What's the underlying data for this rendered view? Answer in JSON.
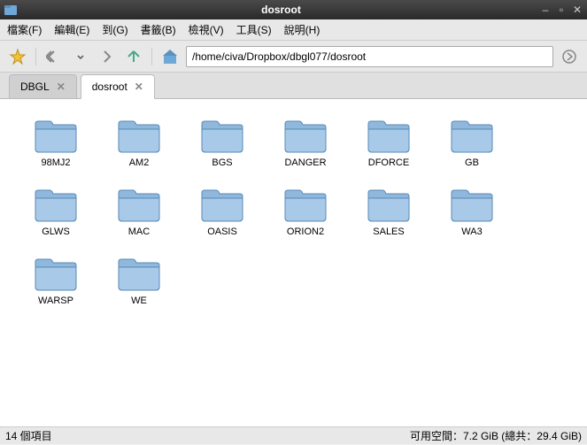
{
  "window": {
    "title": "dosroot"
  },
  "menu": {
    "file": "檔案(F)",
    "edit": "編輯(E)",
    "go": "到(G)",
    "bookmarks": "書籤(B)",
    "view": "檢視(V)",
    "tools": "工具(S)",
    "help": "說明(H)"
  },
  "toolbar": {
    "path": "/home/civa/Dropbox/dbgl077/dosroot"
  },
  "tabs": [
    {
      "label": "DBGL",
      "active": false
    },
    {
      "label": "dosroot",
      "active": true
    }
  ],
  "folders": [
    {
      "name": "98MJ2"
    },
    {
      "name": "AM2"
    },
    {
      "name": "BGS"
    },
    {
      "name": "DANGER"
    },
    {
      "name": "DFORCE"
    },
    {
      "name": "GB"
    },
    {
      "name": "GLWS"
    },
    {
      "name": "MAC"
    },
    {
      "name": "OASIS"
    },
    {
      "name": "ORION2"
    },
    {
      "name": "SALES"
    },
    {
      "name": "WA3"
    },
    {
      "name": "WARSP"
    },
    {
      "name": "WE"
    }
  ],
  "status": {
    "items": "14 個項目",
    "space": "可用空間：7.2 GiB (總共：29.4 GiB)"
  }
}
